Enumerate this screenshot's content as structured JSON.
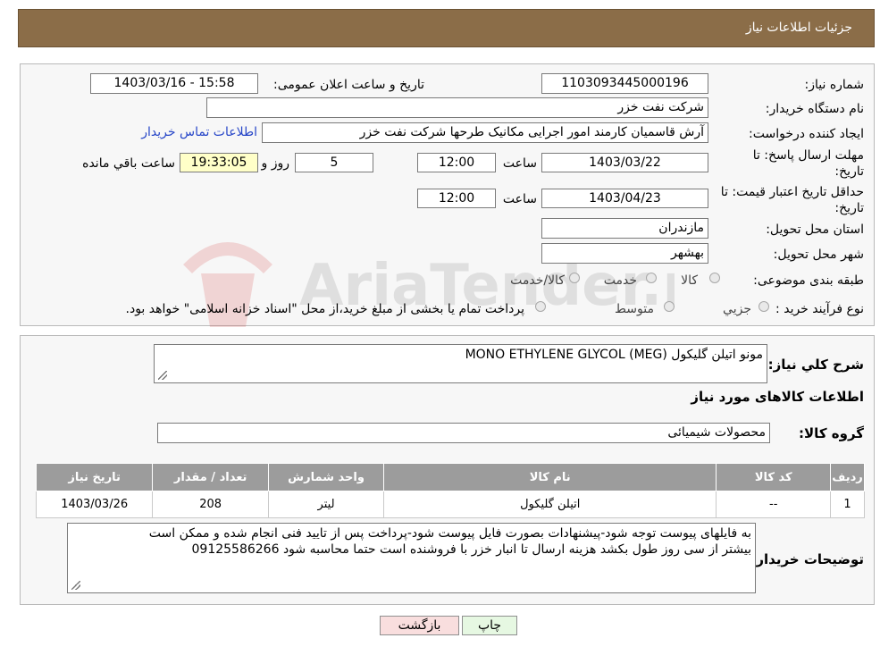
{
  "header": {
    "title": "جزئیات اطلاعات نیاز"
  },
  "need_number": {
    "label": "شماره نیاز:",
    "value": "1103093445000196"
  },
  "announce_datetime": {
    "label": "تاریخ و ساعت اعلان عمومی:",
    "value": "1403/03/16 - 15:58"
  },
  "buyer_org": {
    "label": "نام دستگاه خریدار:",
    "value": "شرکت نفت خزر"
  },
  "requester": {
    "label": "ایجاد کننده درخواست:",
    "value": "آرش قاسمیان کارمند امور اجرایی مکانیک طرحها شرکت نفت خزر",
    "contact_link": "اطلاعات تماس خریدار"
  },
  "reply_deadline": {
    "label": "مهلت ارسال پاسخ: تا تاریخ:",
    "date": "1403/03/22",
    "time_label": "ساعت",
    "time": "12:00",
    "days": "5",
    "days_label": "روز و",
    "remaining": "19:33:05",
    "remaining_label": "ساعت باقي مانده"
  },
  "price_validity": {
    "label": "حداقل تاریخ اعتبار قیمت: تا تاریخ:",
    "date": "1403/04/23",
    "time_label": "ساعت",
    "time": "12:00"
  },
  "province": {
    "label": "استان محل تحویل:",
    "value": "مازندران"
  },
  "city": {
    "label": "شهر محل تحویل:",
    "value": "بهشهر"
  },
  "category": {
    "label": "طبقه بندی موضوعی:",
    "options": [
      "کالا",
      "خدمت",
      "کالا/خدمت"
    ]
  },
  "purchase_type": {
    "label": "نوع فرآیند خرید :",
    "options": [
      "جزيي",
      "متوسط"
    ],
    "note": "پرداخت تمام یا بخشی از مبلغ خرید،از محل \"اسناد خزانه اسلامی\" خواهد بود."
  },
  "description": {
    "label": "شرح كلي نياز:",
    "value": "MONO ETHYLENE GLYCOL (MEG) مونو اتیلن گلیکول"
  },
  "goods_info_title": "اطلاعات کالاهای مورد نیاز",
  "goods_group": {
    "label": "گروه کالا:",
    "value": "محصولات شیمیائی"
  },
  "table": {
    "headers": [
      "ردیف",
      "کد کالا",
      "نام کالا",
      "واحد شمارش",
      "تعداد / مقدار",
      "تاریخ نیاز"
    ],
    "rows": [
      [
        "1",
        "--",
        "اتیلن گلیکول",
        "لیتر",
        "208",
        "1403/03/26"
      ]
    ]
  },
  "buyer_notes": {
    "label": "توضیحات خریدار:",
    "line1": "به فایلهای پیوست توجه شود-پیشنهادات بصورت فایل پیوست شود-پرداخت پس از تایید فنی انجام شده و ممکن است",
    "line2": "بیشتر از سی روز طول بکشد هزینه ارسال تا انبار خزر با فروشنده است حتما محاسبه شود 09125586266"
  },
  "buttons": {
    "back": "بازگشت",
    "print": "چاپ"
  },
  "colors": {
    "header_bg": "#8b6d48",
    "link": "#2746c8",
    "back_button_bg": "#f9dede",
    "print_button_bg": "#e6f8e2"
  }
}
